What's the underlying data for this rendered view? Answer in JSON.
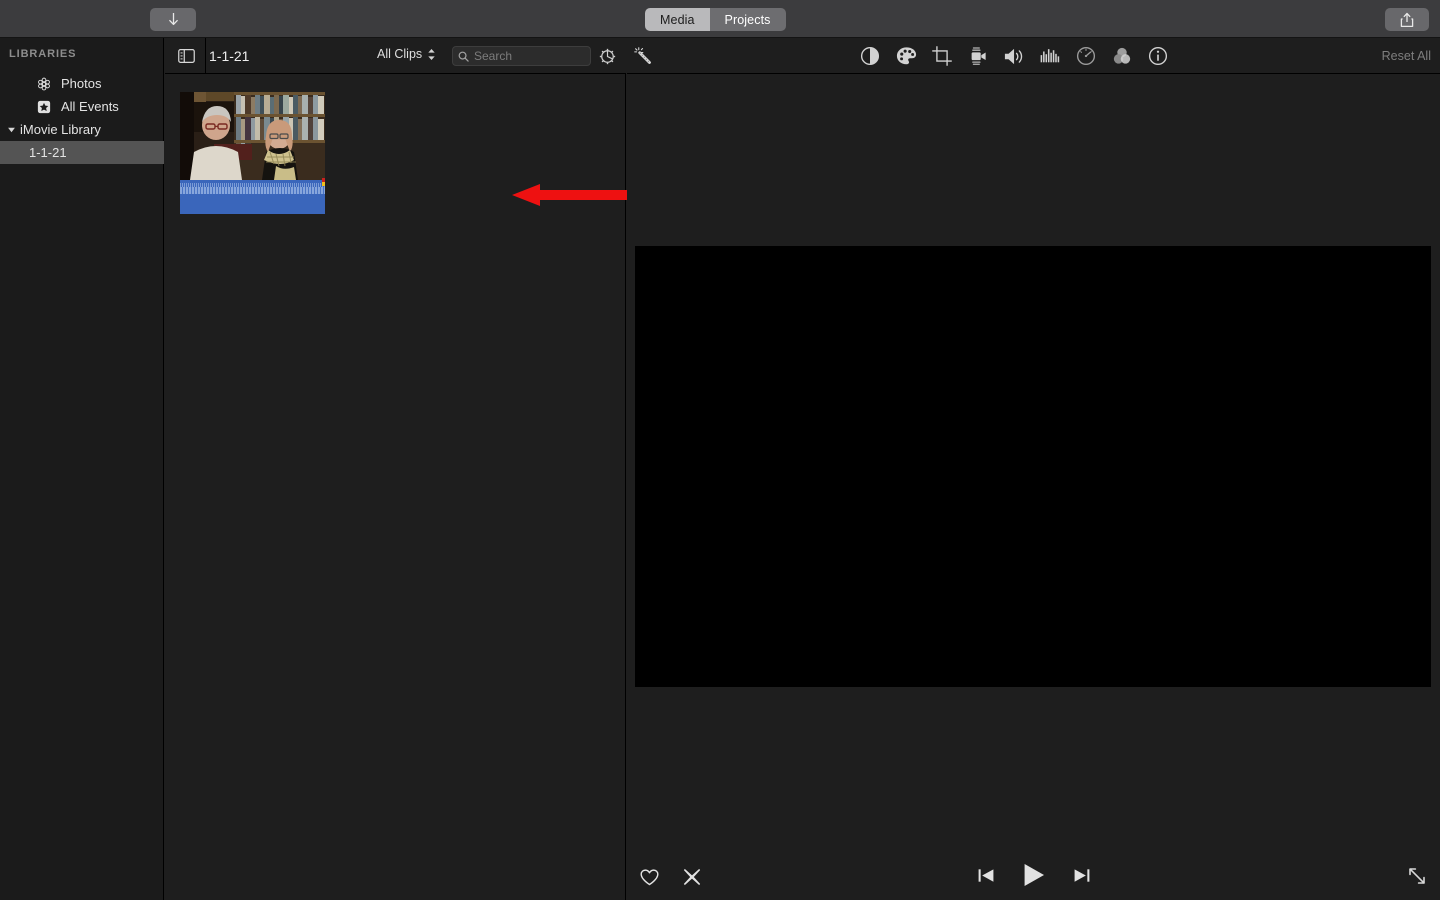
{
  "app": {
    "name": "iMovie",
    "accent_hex": "#545454",
    "annotation_arrow_color": "#ee1111",
    "waveform_color": "#3a66bb",
    "window_bg": "#1e1e1e"
  },
  "titlebar": {
    "import_button": {
      "name": "import-media-button",
      "icon": "download-arrow-icon",
      "tooltip": "Import Media"
    },
    "share_button": {
      "name": "share-button",
      "icon": "share-up-arrow-icon",
      "tooltip": "Share"
    },
    "segments": [
      {
        "label": "Media",
        "selected": true
      },
      {
        "label": "Projects",
        "selected": false
      }
    ]
  },
  "sidebar": {
    "header": "LIBRARIES",
    "items": [
      {
        "label": "Photos",
        "icon": "photos-flower-icon",
        "level": 0,
        "selected": false,
        "disclosure": false
      },
      {
        "label": "All Events",
        "icon": "star-box-icon",
        "level": 0,
        "selected": false,
        "disclosure": false
      },
      {
        "label": "iMovie Library",
        "icon": "library-icon",
        "level": 0,
        "selected": false,
        "disclosure": true
      },
      {
        "label": "1-1-21",
        "icon": "event-icon",
        "level": 1,
        "selected": true,
        "disclosure": false
      }
    ]
  },
  "browser": {
    "sidebar_toggle_icon": "sidebar-panel-icon",
    "title": "1-1-21",
    "filter": {
      "label": "All Clips",
      "icon": "chevron-updown-icon"
    },
    "search": {
      "placeholder": "Search",
      "value": "",
      "icon": "search-icon"
    },
    "settings_icon": "gear-icon",
    "clips": [
      {
        "name": "clip-thumbnail",
        "description": "Two people seated in front of a bookshelf",
        "has_audio_waveform": true,
        "selected": false
      }
    ],
    "annotation": {
      "type": "arrow",
      "direction": "left",
      "color": "#ee1111",
      "points_at": "clip-thumbnail"
    }
  },
  "inspector": {
    "auto_enhance_icon": "magic-wand-icon",
    "reset_all_label": "Reset All",
    "tools": [
      {
        "name": "color-balance",
        "icon": "color-balance-icon"
      },
      {
        "name": "color-correction",
        "icon": "palette-icon"
      },
      {
        "name": "crop",
        "icon": "crop-icon"
      },
      {
        "name": "stabilization",
        "icon": "video-camera-icon"
      },
      {
        "name": "volume",
        "icon": "speaker-icon"
      },
      {
        "name": "noise-reduction-equalizer",
        "icon": "equalizer-bars-icon"
      },
      {
        "name": "speed",
        "icon": "speedometer-icon"
      },
      {
        "name": "clip-filter-audio-effects",
        "icon": "three-circles-icon"
      },
      {
        "name": "information",
        "icon": "info-circle-icon"
      }
    ]
  },
  "viewer": {
    "video_bg": "#000000",
    "controls": {
      "favorite": {
        "name": "favorite-button",
        "icon": "heart-icon"
      },
      "reject": {
        "name": "reject-button",
        "icon": "x-reject-icon"
      },
      "previous": {
        "name": "previous-clip-button",
        "icon": "skip-back-icon"
      },
      "play": {
        "name": "play-button",
        "icon": "play-triangle-icon"
      },
      "next": {
        "name": "next-clip-button",
        "icon": "skip-forward-icon"
      },
      "fullscreen": {
        "name": "fullscreen-button",
        "icon": "diagonal-expand-icon"
      }
    }
  }
}
